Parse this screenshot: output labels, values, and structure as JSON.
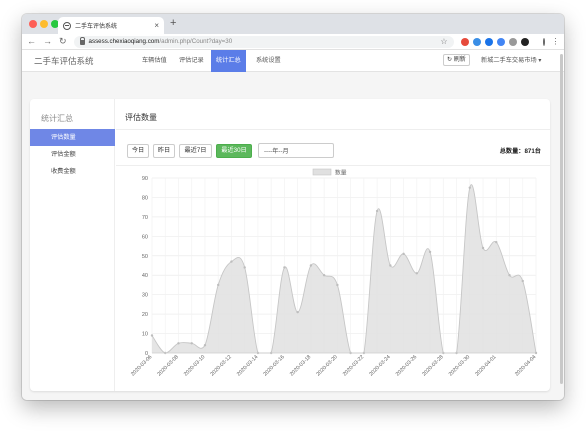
{
  "browser": {
    "tab_title": "二手车评估系统",
    "new_tab": "+",
    "url_host": "assess.chexiaoqiang.com",
    "url_path": "/admin.php/Count?day=30",
    "extension_colors": [
      "#e64a3b",
      "#3a8ee6",
      "#1a73e8",
      "#4285f4",
      "#999999",
      "#222222"
    ]
  },
  "app": {
    "brand": "二手车评估系统",
    "menu": [
      {
        "label": "车辆估值",
        "active": false
      },
      {
        "label": "评估记录",
        "active": false
      },
      {
        "label": "统计汇总",
        "active": true
      },
      {
        "label": "系统设置",
        "active": false
      }
    ],
    "refresh_label": "刷新",
    "market_label": "新城二手车交易市场"
  },
  "sidebar": {
    "title": "统计汇总",
    "items": [
      {
        "label": "评估数量",
        "active": true
      },
      {
        "label": "评估金额",
        "active": false
      },
      {
        "label": "收费金额",
        "active": false
      }
    ]
  },
  "content": {
    "title": "评估数量",
    "filters": [
      {
        "label": "今日",
        "active": false
      },
      {
        "label": "昨日",
        "active": false
      },
      {
        "label": "最近7日",
        "active": false
      },
      {
        "label": "最近30日",
        "active": true
      }
    ],
    "date_value": "----年--月",
    "total_label": "总数量：",
    "total_value": "871台"
  },
  "chart_data": {
    "type": "area",
    "legend": "数量",
    "colors": {
      "fill": "#e0e0e0",
      "line": "#c6c6c6",
      "point": "#bdbdbd"
    },
    "ylim": [
      0,
      90
    ],
    "yticks": [
      0,
      10,
      20,
      30,
      40,
      50,
      60,
      70,
      80,
      90
    ],
    "x": [
      "2020-03-06",
      "2020-03-07",
      "2020-03-08",
      "2020-03-09",
      "2020-03-10",
      "2020-03-11",
      "2020-03-12",
      "2020-03-13",
      "2020-03-14",
      "2020-03-15",
      "2020-03-16",
      "2020-03-17",
      "2020-03-18",
      "2020-03-19",
      "2020-03-20",
      "2020-03-21",
      "2020-03-22",
      "2020-03-23",
      "2020-03-24",
      "2020-03-25",
      "2020-03-26",
      "2020-03-27",
      "2020-03-28",
      "2020-03-29",
      "2020-03-30",
      "2020-03-31",
      "2020-04-01",
      "2020-04-02",
      "2020-04-03",
      "2020-04-04"
    ],
    "xtick_labels": [
      "2020-03-06",
      "2020-03-08",
      "2020-03-10",
      "2020-03-12",
      "2020-03-14",
      "2020-03-16",
      "2020-03-18",
      "2020-03-20",
      "2020-03-22",
      "2020-03-24",
      "2020-03-26",
      "2020-03-28",
      "2020-03-30",
      "2020-04-01",
      "2020-04-04"
    ],
    "values": [
      9,
      0,
      5,
      5,
      4,
      35,
      47,
      44,
      0,
      0,
      44,
      21,
      45,
      40,
      35,
      0,
      0,
      73,
      45,
      51,
      41,
      52,
      0,
      0,
      85,
      54,
      57,
      40,
      37,
      0
    ]
  }
}
